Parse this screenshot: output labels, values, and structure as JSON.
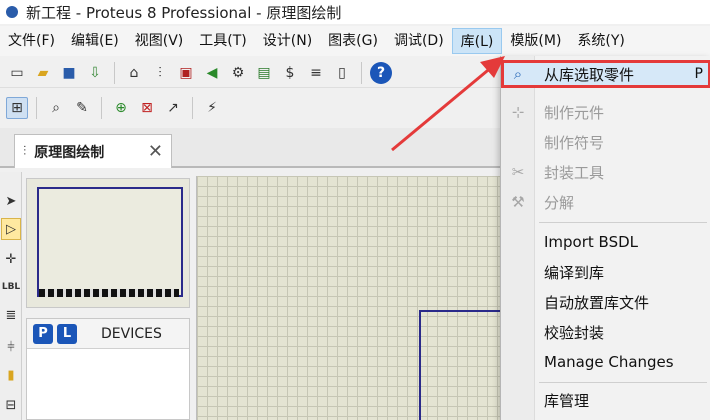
{
  "window": {
    "title": "新工程 - Proteus 8 Professional - 原理图绘制"
  },
  "menu": [
    {
      "label": "文件(F)"
    },
    {
      "label": "编辑(E)"
    },
    {
      "label": "视图(V)"
    },
    {
      "label": "工具(T)"
    },
    {
      "label": "设计(N)"
    },
    {
      "label": "图表(G)"
    },
    {
      "label": "调试(D)"
    },
    {
      "label": "库(L)",
      "active": true
    },
    {
      "label": "模版(M)"
    },
    {
      "label": "系统(Y)"
    }
  ],
  "tab": {
    "label": "原理图绘制"
  },
  "left_sidebar": {
    "label_icon_text": "LBL"
  },
  "devices_panel": {
    "p_button": "P",
    "l_button": "L",
    "title": "DEVICES"
  },
  "library_menu": {
    "items": [
      {
        "label": "从库选取零件",
        "shortcut": "P",
        "icon": "pick-parts-icon",
        "enabled": true,
        "highlighted": true
      },
      {
        "label": "制作元件",
        "icon": "make-device-icon",
        "enabled": false
      },
      {
        "label": "制作符号",
        "icon": "",
        "enabled": false
      },
      {
        "label": "封装工具",
        "icon": "packaging-tool-icon",
        "enabled": false
      },
      {
        "label": "分解",
        "icon": "decompose-icon",
        "enabled": false
      },
      {
        "label": "Import BSDL",
        "icon": "",
        "enabled": true
      },
      {
        "label": "编译到库",
        "icon": "",
        "enabled": true
      },
      {
        "label": "自动放置库文件",
        "icon": "",
        "enabled": true
      },
      {
        "label": "校验封装",
        "icon": "",
        "enabled": true
      },
      {
        "label": "Manage Changes",
        "icon": "",
        "enabled": true
      },
      {
        "label": "库管理",
        "icon": "",
        "enabled": true
      }
    ]
  },
  "colors": {
    "highlight_border": "#e43a3a",
    "arrow": "#e43a3a",
    "grid": "#e4e4d2",
    "sheet_border": "#2a2a8a"
  }
}
